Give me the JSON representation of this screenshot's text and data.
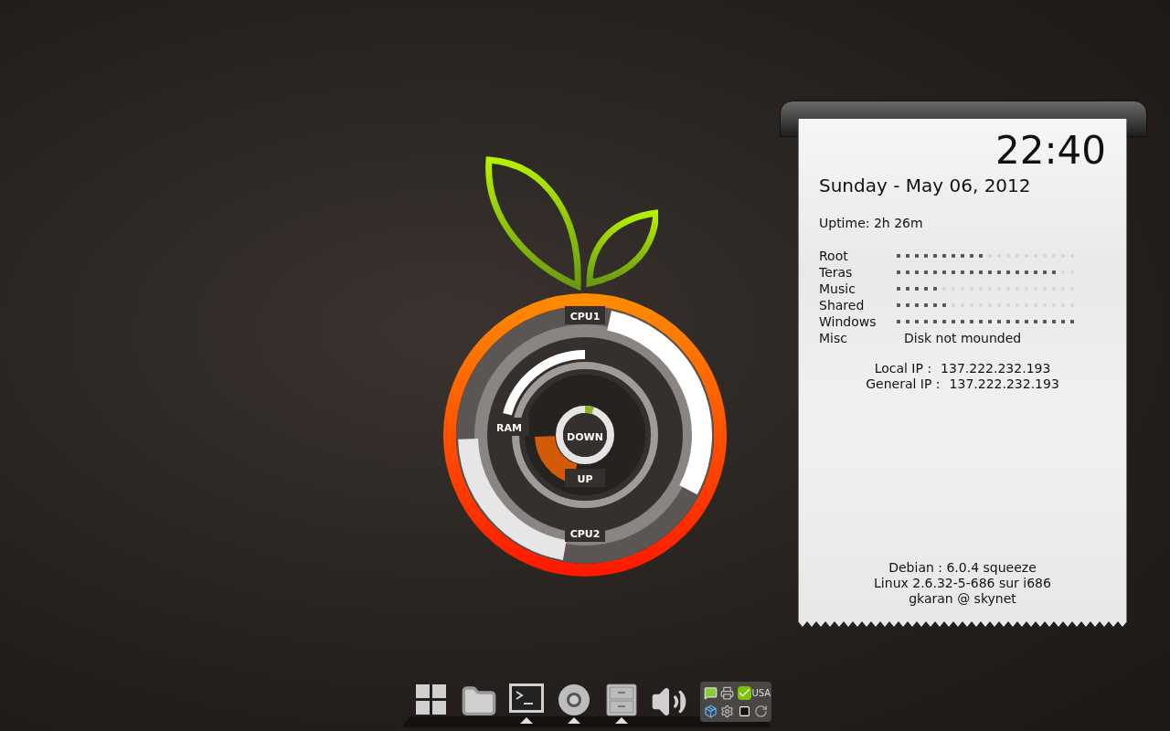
{
  "gauge": {
    "rings": [
      {
        "kind": "cpu1",
        "label": "CPU1"
      },
      {
        "kind": "ram",
        "label": "RAM"
      },
      {
        "kind": "down",
        "label": "DOWN"
      },
      {
        "kind": "up",
        "label": "UP"
      },
      {
        "kind": "cpu2",
        "label": "CPU2"
      }
    ]
  },
  "info": {
    "clock": "22:40",
    "date": "Sunday - May 06, 2012",
    "uptime": "Uptime: 2h 26m",
    "disks": [
      {
        "name": "Root",
        "kind": "bar",
        "level": 0.5
      },
      {
        "name": "Teras",
        "kind": "bar",
        "level": 0.9
      },
      {
        "name": "Music",
        "kind": "bar",
        "level": 0.25
      },
      {
        "name": "Shared",
        "kind": "bar",
        "level": 0.3
      },
      {
        "name": "Windows",
        "kind": "bar",
        "level": 1.0
      },
      {
        "name": "Misc",
        "kind": "text",
        "status": "Disk not mounded"
      }
    ],
    "network": [
      {
        "label": "Local IP :",
        "value": "137.222.232.193"
      },
      {
        "label": "General IP :",
        "value": "137.222.232.193"
      }
    ],
    "footer": [
      "Debian : 6.0.4 squeeze",
      "Linux 2.6.32-5-686 sur i686",
      "gkaran @ skynet"
    ]
  },
  "dock": {
    "items": [
      {
        "kind": "grid",
        "running": false
      },
      {
        "kind": "folder",
        "running": false
      },
      {
        "kind": "terminal",
        "running": true
      },
      {
        "kind": "browser",
        "running": true
      },
      {
        "kind": "cabinet",
        "running": true
      },
      {
        "kind": "speaker",
        "running": false
      }
    ],
    "tray": {
      "layout": "USA"
    }
  }
}
